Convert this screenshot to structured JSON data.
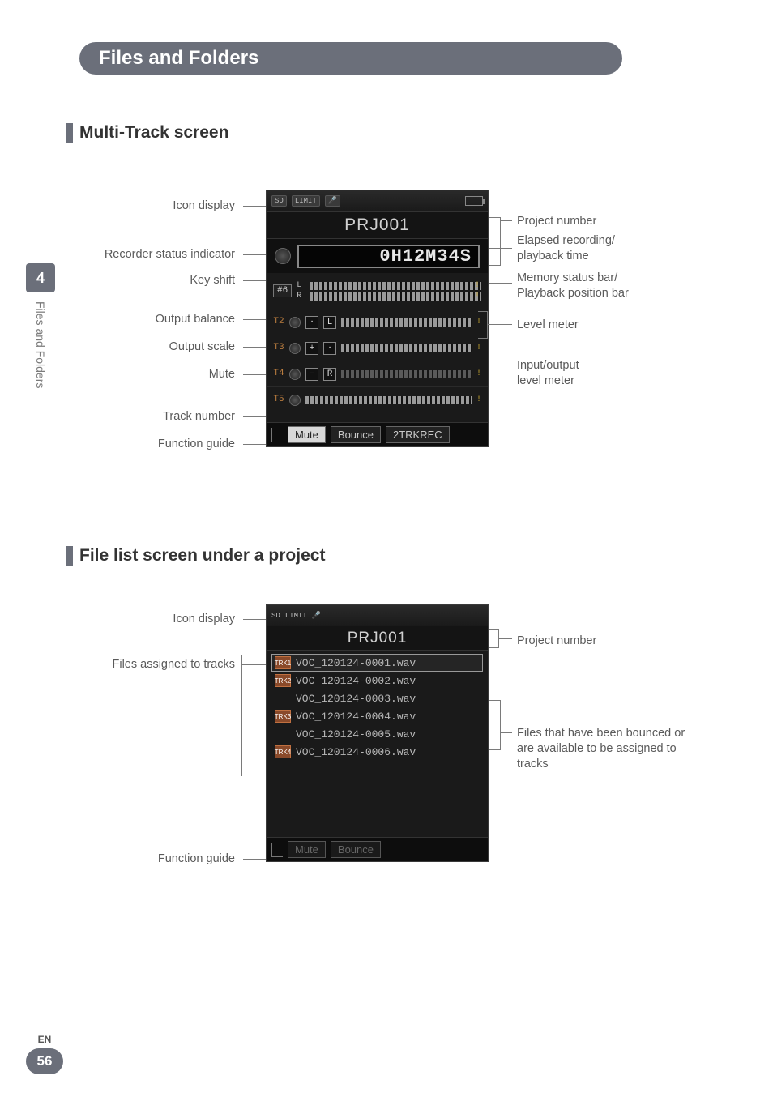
{
  "header": {
    "title": "Files and Folders"
  },
  "sideTab": {
    "chapter": "4",
    "vertical": "Files and Folders"
  },
  "section1": {
    "title": "Multi-Track screen",
    "leftLabels": {
      "iconDisplay": "Icon display",
      "recorderStatus": "Recorder status indicator",
      "keyShift": "Key shift",
      "outputBalance": "Output balance",
      "outputScale": "Output scale",
      "mute": "Mute",
      "trackNumber": "Track number",
      "functionGuide": "Function guide"
    },
    "rightLabels": {
      "projectNumber": "Project number",
      "elapsed": "Elapsed recording/\nplayback time",
      "memory": "Memory status bar/\nPlayback position bar",
      "levelMeter": "Level meter",
      "ioMeter": "Input/output\nlevel meter"
    },
    "lcd": {
      "sd": "SD",
      "limit": "LIMIT",
      "prj": "PRJ001",
      "time": "0H12M34S",
      "keyShiftValue": "#6",
      "lrL": "L",
      "lrR": "R",
      "tracks": [
        {
          "num": "T2",
          "sym": "L"
        },
        {
          "num": "T3",
          "sym": "+"
        },
        {
          "num": "T4",
          "sym": "−",
          "mute": "R"
        },
        {
          "num": "T5",
          "sym": ""
        }
      ],
      "fn": {
        "mute": "Mute",
        "bounce": "Bounce",
        "rec": "2TRKREC"
      }
    }
  },
  "section2": {
    "title": "File list screen under a project",
    "leftLabels": {
      "iconDisplay": "Icon display",
      "filesAssigned": "Files assigned to tracks",
      "functionGuide": "Function guide"
    },
    "rightLabels": {
      "projectNumber": "Project number",
      "filesBounced": "Files that have been bounced or are available to be assigned to tracks"
    },
    "lcd": {
      "sd": "SD",
      "prj": "PRJ001",
      "files": [
        {
          "trk": "1",
          "name": "VOC_120124-0001.wav",
          "assigned": true,
          "sel": true
        },
        {
          "trk": "2",
          "name": "VOC_120124-0002.wav",
          "assigned": true
        },
        {
          "trk": "",
          "name": "VOC_120124-0003.wav",
          "assigned": false
        },
        {
          "trk": "3",
          "name": "VOC_120124-0004.wav",
          "assigned": true
        },
        {
          "trk": "",
          "name": "VOC_120124-0005.wav",
          "assigned": false
        },
        {
          "trk": "4",
          "name": "VOC_120124-0006.wav",
          "assigned": true
        }
      ],
      "fn": {
        "mute": "Mute",
        "bounce": "Bounce"
      }
    }
  },
  "footer": {
    "lang": "EN",
    "page": "56"
  }
}
